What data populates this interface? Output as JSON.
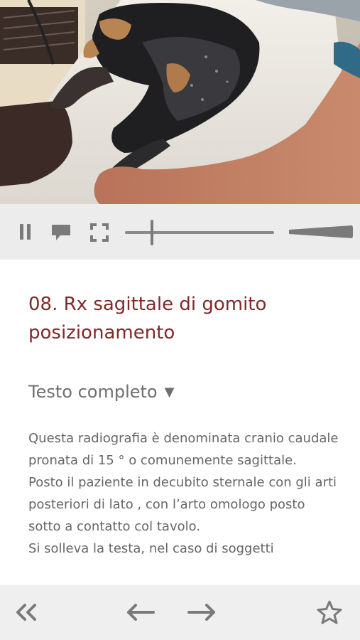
{
  "video": {
    "state": "playing",
    "seek_progress": 0.18,
    "volume_level": 0.9
  },
  "article": {
    "title": "08. Rx sagittale di gomito posizionamento",
    "section_label": "Testo completo",
    "section_arrow": "▼",
    "paragraphs": [
      "Questa radiografia è denominata cranio caudale pronata di 15 ° o comunemente sagittale.",
      "Posto il paziente in decubito sternale con gli arti posteriori di lato , con l’arto omologo posto sotto a contatto col tavolo.",
      "Si solleva la testa, nel caso di soggetti"
    ]
  },
  "icons": {
    "pause": "pause-icon",
    "comment": "comment-icon",
    "fullscreen": "fullscreen-icon",
    "first": "double-chevron-left-icon",
    "prev": "arrow-left-icon",
    "next": "arrow-right-icon",
    "bookmark": "star-icon"
  },
  "colors": {
    "title": "#7e2a2a",
    "text": "#666666",
    "controls_bg": "#ececec",
    "icon": "#7a7a7a"
  }
}
